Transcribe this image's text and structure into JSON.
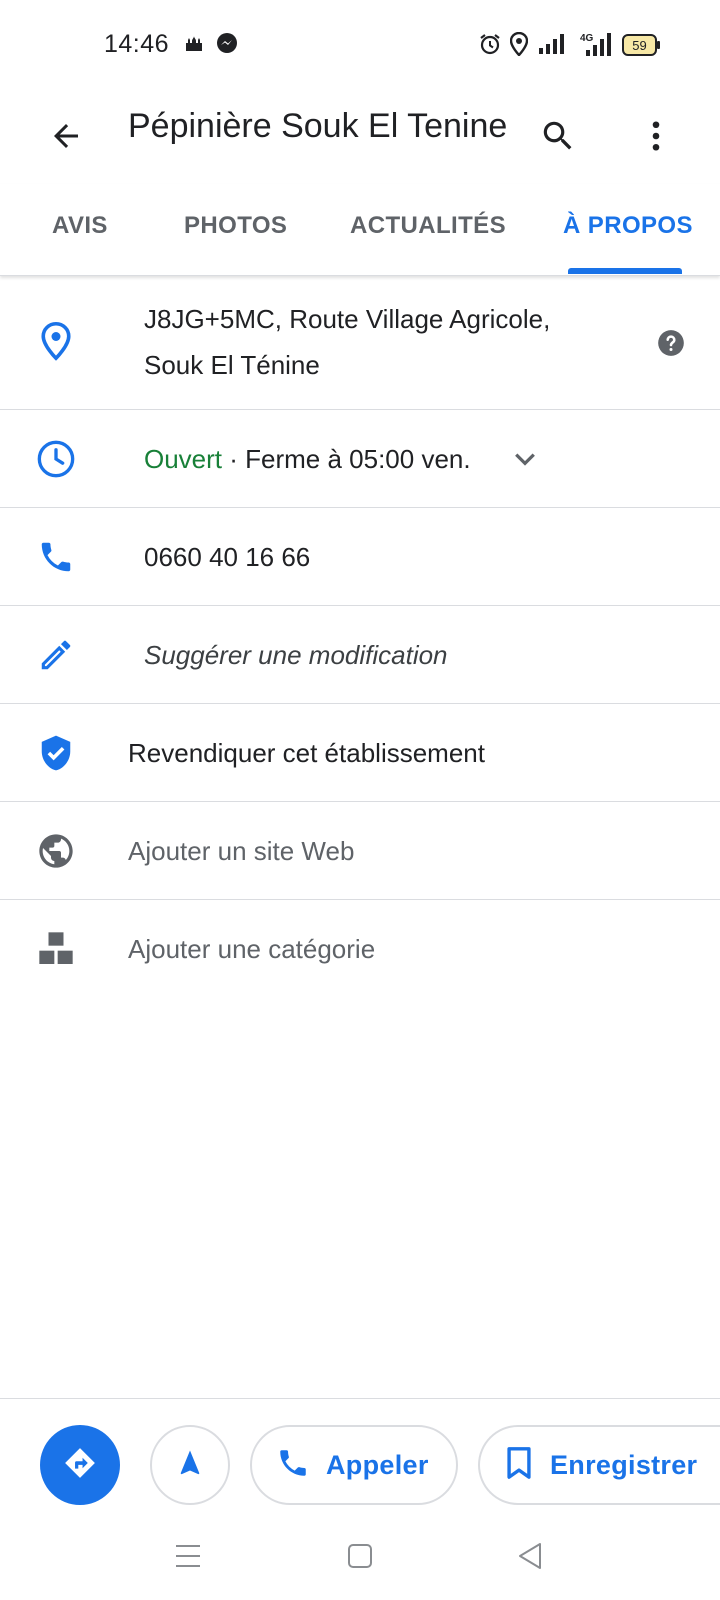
{
  "status_bar": {
    "time": "14:46",
    "network": "4G",
    "battery": "59",
    "icons": [
      "mosque-icon",
      "messenger-icon",
      "alarm-icon",
      "location-icon",
      "signal-icon",
      "signal-4g-icon",
      "battery-icon"
    ]
  },
  "app_bar": {
    "title": "Pépinière Souk El Tenine",
    "back_icon": "arrow-back-icon",
    "search_icon": "search-icon",
    "more_icon": "more-vert-icon"
  },
  "tabs": [
    {
      "label": "AVIS",
      "active": false
    },
    {
      "label": "PHOTOS",
      "active": false
    },
    {
      "label": "ACTUALITÉS",
      "active": false
    },
    {
      "label": "À PROPOS",
      "active": true
    }
  ],
  "info": {
    "address_line1": "J8JG+5MC, Route Village Agricole,",
    "address_line2": "Souk El Ténine",
    "hours_status": "Ouvert",
    "hours_detail": " · Ferme à 05:00 ven.",
    "phone": "0660 40 16 66",
    "suggest_edit": "Suggérer une modification",
    "claim": "Revendiquer cet établissement",
    "add_website": "Ajouter un site Web",
    "add_category": "Ajouter une catégorie"
  },
  "actions": {
    "call_label": "Appeler",
    "save_label": "Enregistrer"
  },
  "colors": {
    "accent": "#1a73e8",
    "open_green": "#188038",
    "text_primary": "#202124",
    "text_secondary": "#5f6368",
    "divider": "#dadce0"
  }
}
